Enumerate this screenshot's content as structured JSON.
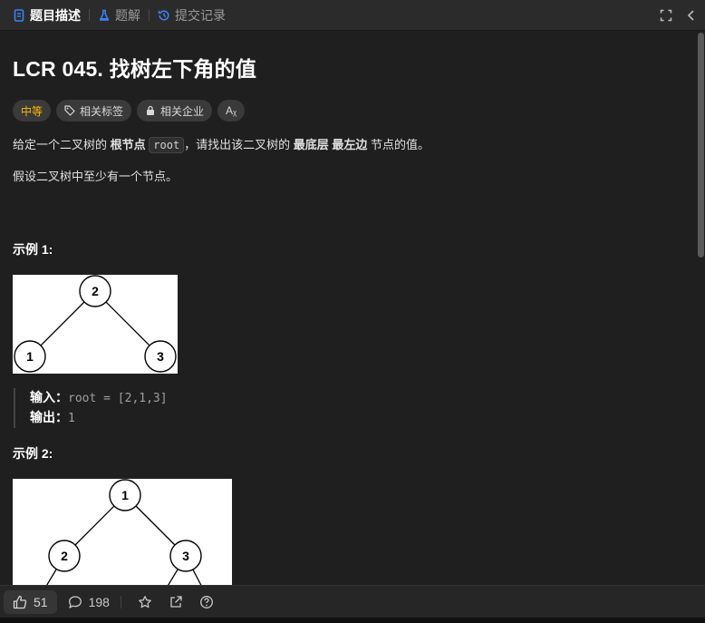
{
  "tabs": [
    {
      "label": "题目描述",
      "icon": "document-icon"
    },
    {
      "label": "题解",
      "icon": "flask-icon"
    },
    {
      "label": "提交记录",
      "icon": "history-icon"
    }
  ],
  "problem": {
    "title": "LCR 045. 找树左下角的值",
    "difficulty": "中等",
    "tags": [
      {
        "label": "相关标签",
        "icon": "tag-icon"
      },
      {
        "label": "相关企业",
        "icon": "lock-icon"
      },
      {
        "label": "Aᵪ",
        "icon": "translate-icon"
      }
    ],
    "desc": {
      "p1_a": "给定一个二叉树的 ",
      "p1_b": "根节点",
      "p1_code": "root",
      "p1_c": "，请找出该二叉树的 ",
      "p1_d": "最底层 最左边",
      "p1_e": " 节点的值。",
      "p2": "假设二叉树中至少有一个节点。"
    }
  },
  "examples": [
    {
      "title": "示例 1:",
      "input_label": "输入：",
      "input_value": "root = [2,1,3]",
      "output_label": "输出：",
      "output_value": "1",
      "tree": {
        "root": "2",
        "left": "1",
        "right": "3"
      }
    },
    {
      "title": "示例 2:",
      "tree": {
        "root": "1",
        "left": "2",
        "right": "3"
      }
    }
  ],
  "bottom": {
    "likes": "51",
    "comments": "198"
  },
  "colors": {
    "background": "#1f1f1f",
    "difficulty_medium": "#ffb800",
    "tag_bg": "#3a3a3a"
  }
}
